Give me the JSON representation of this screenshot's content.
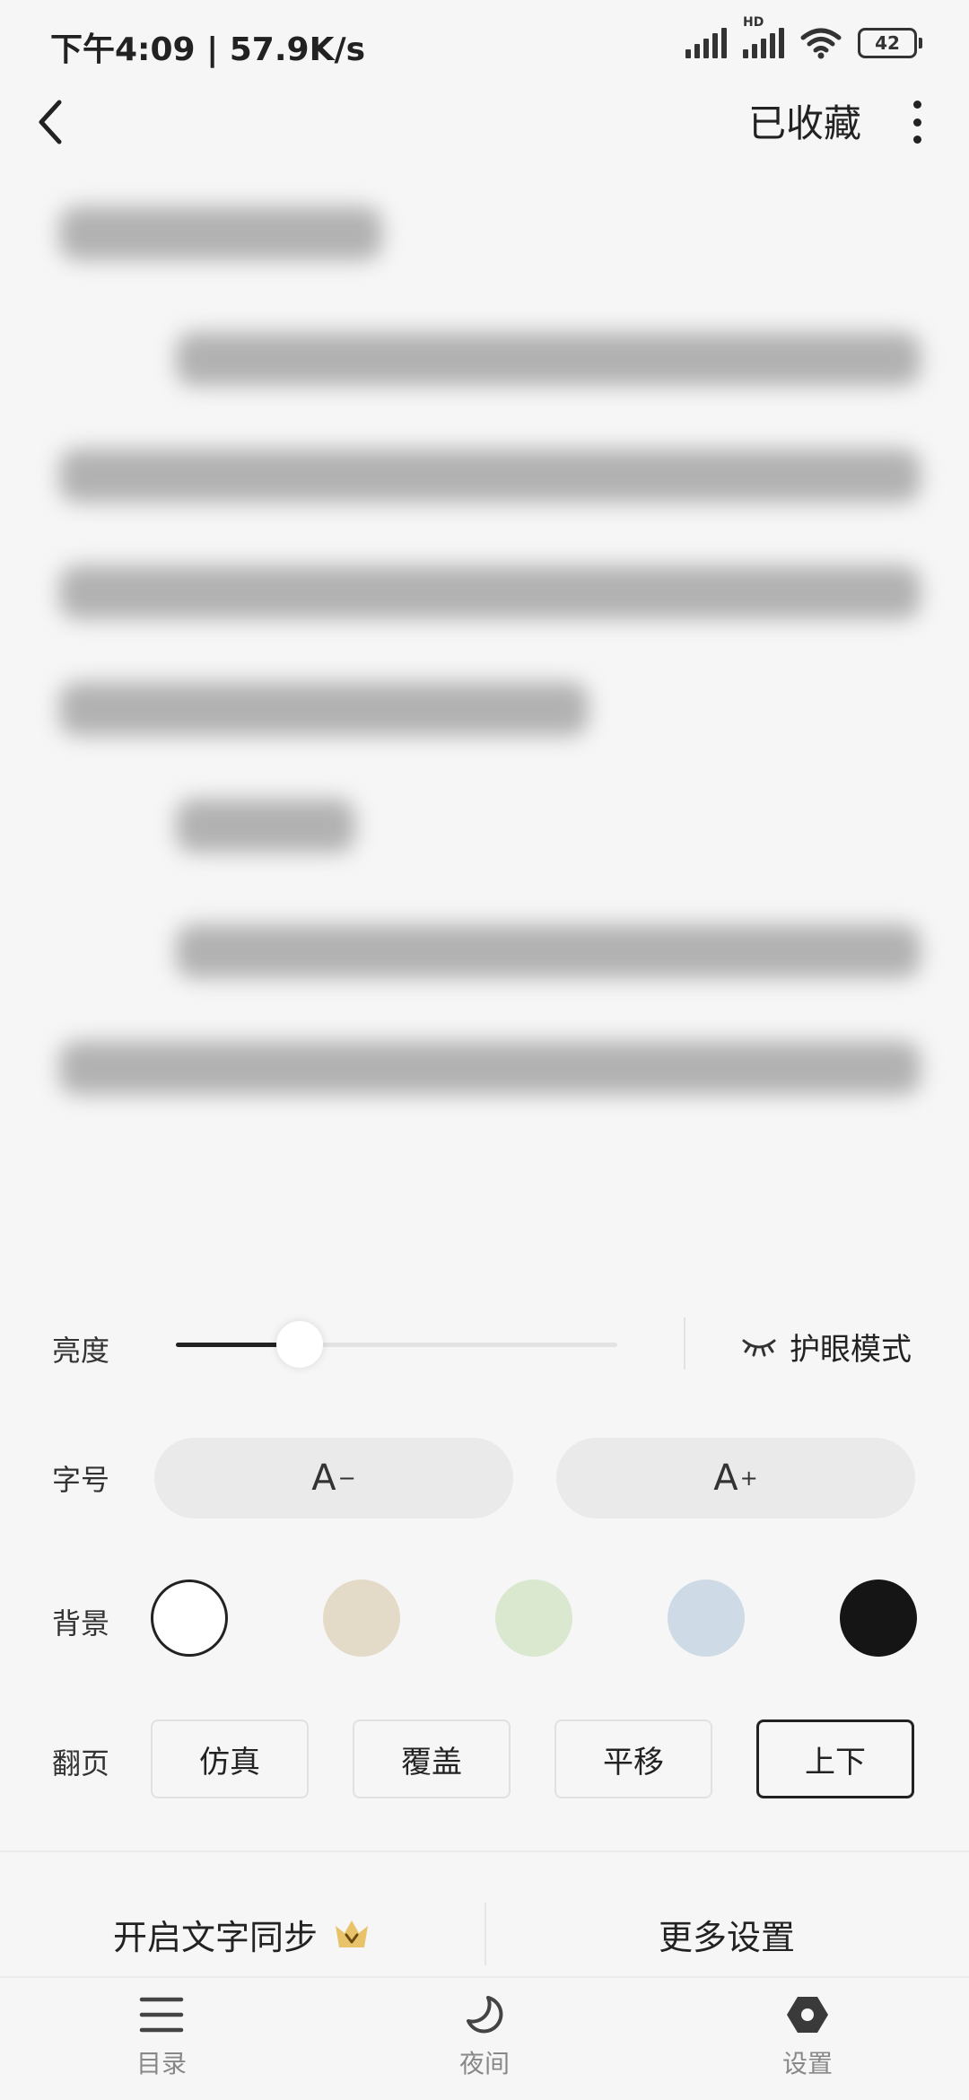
{
  "status": {
    "time": "下午4:09 | 57.9K/s",
    "battery": "42",
    "hd": "HD"
  },
  "topbar": {
    "collected_label": "已收藏"
  },
  "panel": {
    "brightness": {
      "label": "亮度",
      "level": 0.28
    },
    "eye_mode_label": "护眼模式",
    "font": {
      "label": "字号",
      "decrease": "A",
      "decrease_sup": "−",
      "increase": "A",
      "increase_sup": "+"
    },
    "background": {
      "label": "背景",
      "swatches": [
        "#ffffff",
        "#e3dbc8",
        "#d9e8cf",
        "#cedbe6",
        "#151515"
      ],
      "selected": 0
    },
    "page_turn": {
      "label": "翻页",
      "options": [
        "仿真",
        "覆盖",
        "平移",
        "上下"
      ],
      "selected": 3
    },
    "sync_text_label": "开启文字同步",
    "more_settings_label": "更多设置"
  },
  "tabbar": {
    "items": [
      {
        "label": "目录"
      },
      {
        "label": "夜间"
      },
      {
        "label": "设置"
      }
    ]
  },
  "colors": {
    "accent": "#222222",
    "vip_crown": "#e8c36a"
  }
}
